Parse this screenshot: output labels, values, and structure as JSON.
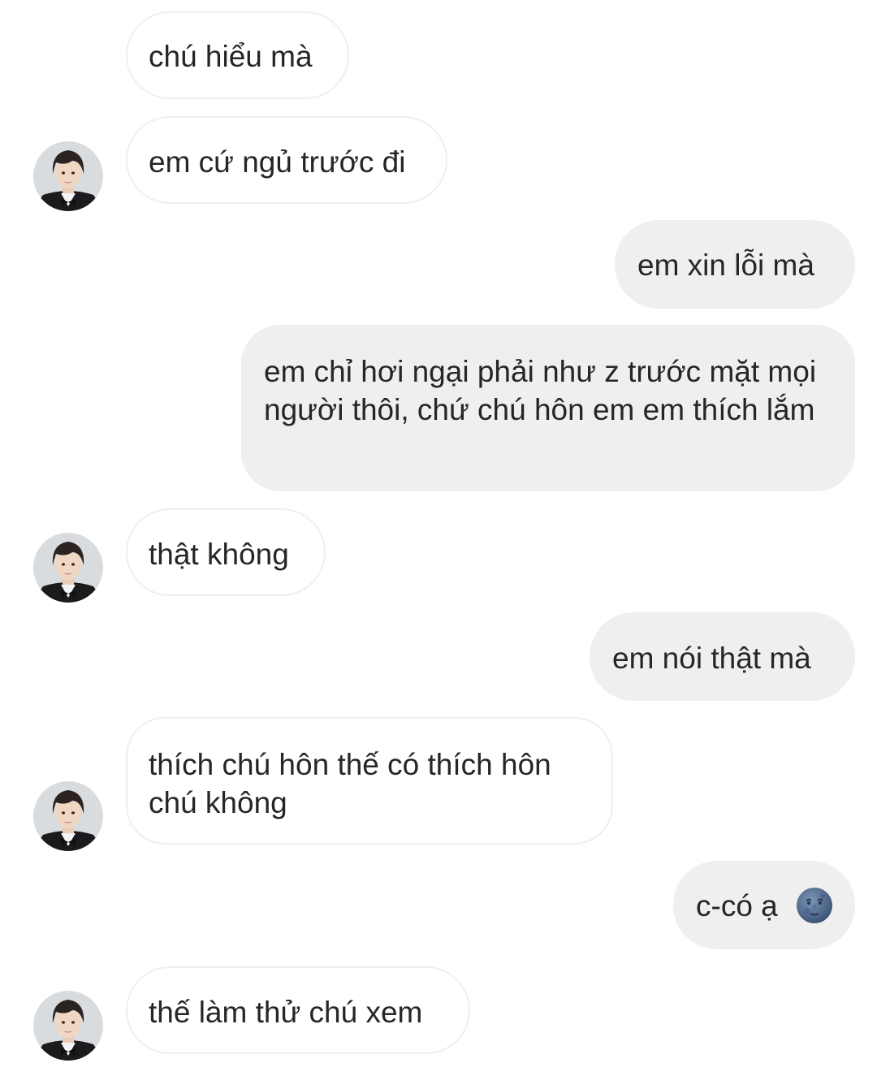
{
  "colors": {
    "incoming_bubble_bg": "#ffffff",
    "incoming_bubble_border": "#efefef",
    "outgoing_bubble_bg": "#efefef",
    "text": "#262626"
  },
  "messages": [
    {
      "direction": "incoming",
      "text": "chú hiểu mà"
    },
    {
      "direction": "incoming",
      "text": "em cứ ngủ trước đi",
      "avatar": "contact-avatar"
    },
    {
      "direction": "outgoing",
      "text": "em xin lỗi mà"
    },
    {
      "direction": "outgoing",
      "text": "em chỉ hơi ngại phải như z trước mặt mọi người thôi, chứ chú hôn em em thích lắm"
    },
    {
      "direction": "incoming",
      "text": "thật không",
      "avatar": "contact-avatar"
    },
    {
      "direction": "outgoing",
      "text": "em nói thật mà"
    },
    {
      "direction": "incoming",
      "text": "thích chú hôn thế có thích hôn chú không",
      "avatar": "contact-avatar"
    },
    {
      "direction": "outgoing",
      "text": "c-có ạ",
      "emoji": "new-moon-face-icon"
    },
    {
      "direction": "incoming",
      "text": "thế làm thử chú xem",
      "avatar": "contact-avatar"
    }
  ]
}
